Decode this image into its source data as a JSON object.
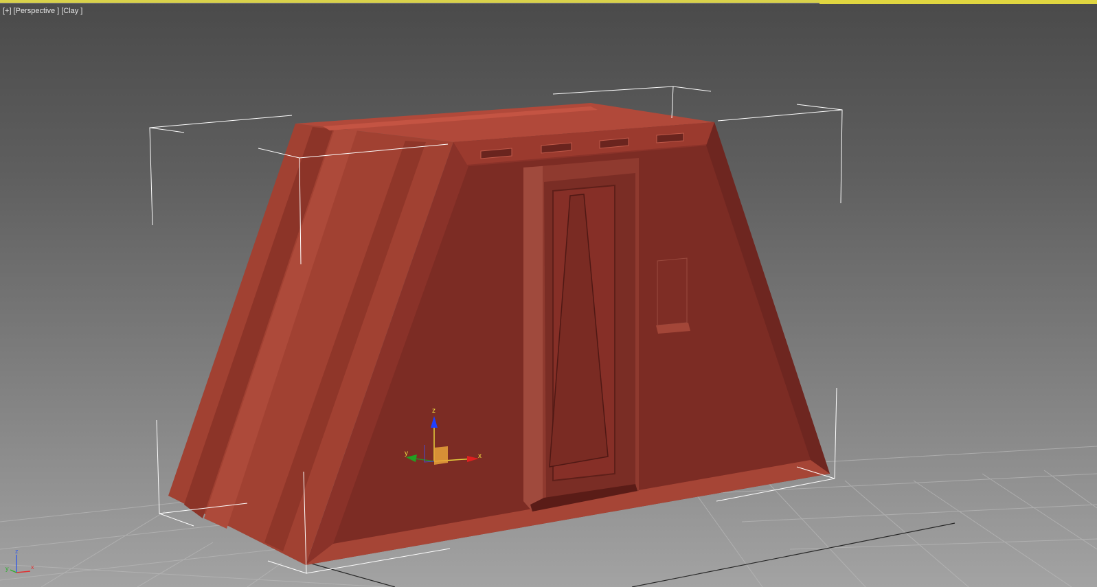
{
  "viewport": {
    "labels": [
      {
        "text": "[+]"
      },
      {
        "text": "[Perspective ]"
      },
      {
        "text": "[Clay ]"
      }
    ],
    "projection": "Perspective",
    "shading": "Clay",
    "object_color": "#8a3229",
    "selection_bracket_color": "#ffffff",
    "background_top": "#4a4a4a",
    "background_bottom": "#a3a3a3"
  },
  "gizmo": {
    "axes": [
      {
        "label": "z",
        "color": "#2040ff"
      },
      {
        "label": "y",
        "color": "#22a022"
      },
      {
        "label": "x",
        "color": "#e02020"
      }
    ]
  },
  "view_axis": {
    "axes": [
      {
        "label": "z",
        "color": "#3a5fe0"
      },
      {
        "label": "y",
        "color": "#2fb02f"
      },
      {
        "label": "x",
        "color": "#e03030"
      }
    ]
  }
}
